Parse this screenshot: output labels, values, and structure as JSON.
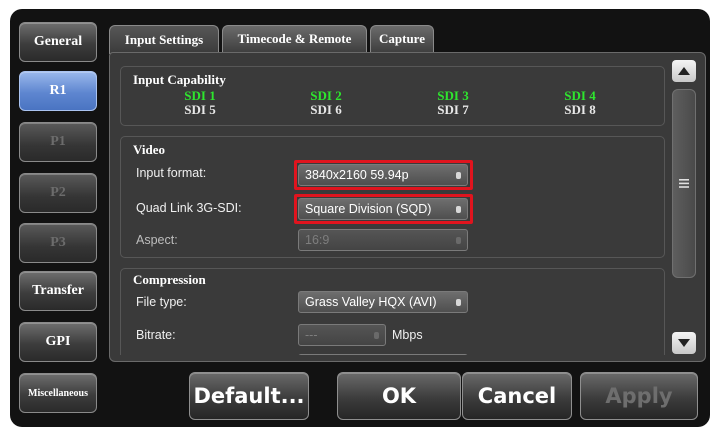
{
  "nav": {
    "items": [
      {
        "label": "General",
        "state": "normal"
      },
      {
        "label": "R1",
        "state": "active"
      },
      {
        "label": "P1",
        "state": "disabled"
      },
      {
        "label": "P2",
        "state": "disabled"
      },
      {
        "label": "P3",
        "state": "disabled"
      },
      {
        "label": "Transfer",
        "state": "normal"
      },
      {
        "label": "GPI",
        "state": "normal"
      },
      {
        "label": "Miscellaneous",
        "state": "normal"
      }
    ]
  },
  "tabs": [
    {
      "label": "Input Settings",
      "active": true
    },
    {
      "label": "Timecode & Remote",
      "active": false
    },
    {
      "label": "Capture",
      "active": false
    }
  ],
  "input_capability": {
    "title": "Input Capability",
    "active": [
      "SDI 1",
      "SDI 2",
      "SDI 3",
      "SDI 4"
    ],
    "inactive": [
      "SDI 5",
      "SDI 6",
      "SDI 7",
      "SDI 8"
    ]
  },
  "video": {
    "title": "Video",
    "input_format_label": "Input format:",
    "input_format_value": "3840x2160 59.94p",
    "quad_link_label": "Quad Link 3G-SDI:",
    "quad_link_value": "Square Division (SQD)",
    "aspect_label": "Aspect:",
    "aspect_value": "16:9"
  },
  "compression": {
    "title": "Compression",
    "file_type_label": "File type:",
    "file_type_value": "Grass Valley HQX (AVI)",
    "bitrate_label": "Bitrate:",
    "bitrate_value": "---",
    "bitrate_unit": "Mbps"
  },
  "buttons": {
    "default": "Default...",
    "ok": "OK",
    "cancel": "Cancel",
    "apply": "Apply"
  },
  "icons": {
    "scroll_up": "up-arrow-icon",
    "scroll_down": "down-arrow-icon",
    "thumb_grip": "grip-icon"
  },
  "colors": {
    "active_sdi": "#2ee62e",
    "highlight": "#e0141e",
    "nav_active": "#5e86d0"
  }
}
